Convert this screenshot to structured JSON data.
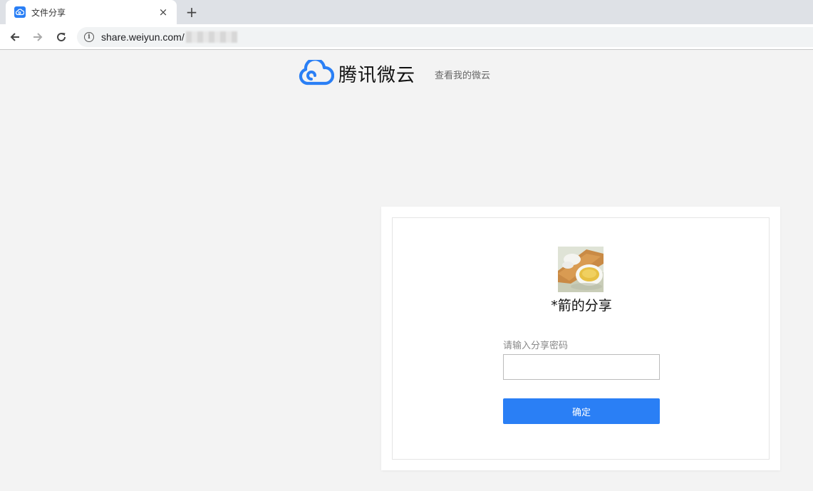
{
  "browser": {
    "tab_title": "文件分享",
    "url": "share.weiyun.com/",
    "new_tab": "+",
    "close": "×"
  },
  "header": {
    "logo_text": "腾讯微云",
    "link": "查看我的微云"
  },
  "share": {
    "title": "*箭的分享",
    "password_label": "请输入分享密码",
    "password_value": "",
    "confirm_label": "确定"
  },
  "colors": {
    "brand_blue": "#2a7ff5",
    "page_bg": "#f3f3f3"
  },
  "icons": {
    "favicon": "weiyun-cloud-icon",
    "back": "arrow-left-icon",
    "forward": "arrow-right-icon",
    "reload": "reload-icon",
    "info": "info-icon",
    "logo": "cloud-logo-icon"
  }
}
